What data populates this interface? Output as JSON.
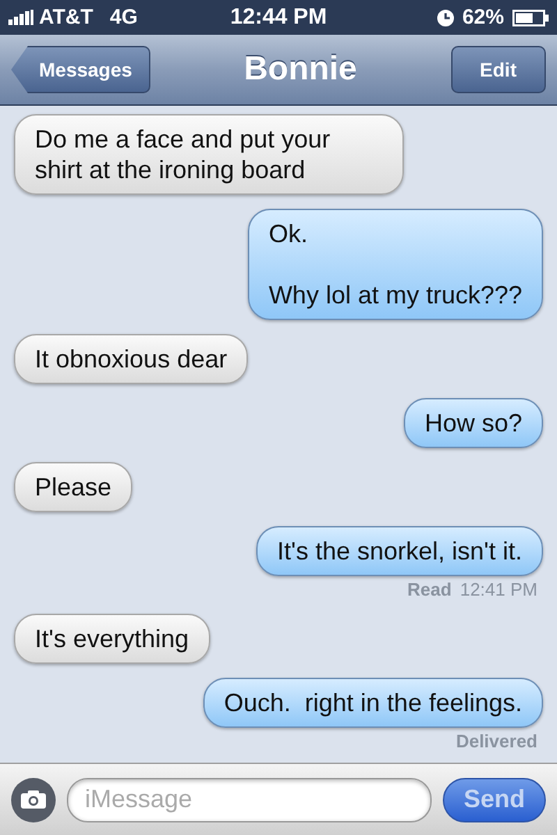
{
  "status_bar": {
    "carrier": "AT&T",
    "network": "4G",
    "time": "12:44 PM",
    "battery": "62%"
  },
  "nav": {
    "back": "Messages",
    "title": "Bonnie",
    "action": "Edit"
  },
  "messages": [
    {
      "kind": "received",
      "text": "Do me a face and put your shirt at the ironing board"
    },
    {
      "kind": "sent",
      "text": "Ok.\n\nWhy lol at my truck???"
    },
    {
      "kind": "received",
      "text": "It obnoxious dear"
    },
    {
      "kind": "sent",
      "text": "How so?"
    },
    {
      "kind": "received",
      "text": "Please"
    },
    {
      "kind": "sent",
      "text": "It's the snorkel, isn't it."
    },
    {
      "kind": "note",
      "status": "Read",
      "time": "12:41 PM"
    },
    {
      "kind": "received",
      "text": "It's everything"
    },
    {
      "kind": "sent",
      "text": "Ouch.  right in the feelings."
    },
    {
      "kind": "note",
      "status": "Delivered"
    }
  ],
  "composer": {
    "placeholder": "iMessage",
    "send": "Send"
  }
}
